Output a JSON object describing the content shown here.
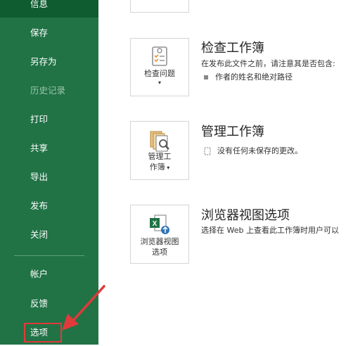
{
  "sidebar": {
    "items": [
      {
        "label": "信息"
      },
      {
        "label": "保存"
      },
      {
        "label": "另存为"
      },
      {
        "label": "历史记录"
      },
      {
        "label": "打印"
      },
      {
        "label": "共享"
      },
      {
        "label": "导出"
      },
      {
        "label": "发布"
      },
      {
        "label": "关闭"
      },
      {
        "label": "帐户"
      },
      {
        "label": "反馈"
      },
      {
        "label": "选项"
      }
    ]
  },
  "main": {
    "inspect": {
      "button_label": "检查问题",
      "title": "检查工作簿",
      "description": "在发布此文件之前，请注意其是否包含:",
      "bullets": [
        "作者的姓名和绝对路径"
      ]
    },
    "manage": {
      "button_line1": "管理工",
      "button_line2": "作簿",
      "title": "管理工作簿",
      "status": "没有任何未保存的更改。"
    },
    "browser": {
      "button_line1": "浏览器视图",
      "button_line2": "选项",
      "title": "浏览器视图选项",
      "description": "选择在 Web 上查看此工作簿时用户可以"
    }
  },
  "colors": {
    "sidebar_bg": "#217346",
    "selected_bg": "#0e5c2f",
    "annotation": "#e03a3a"
  }
}
